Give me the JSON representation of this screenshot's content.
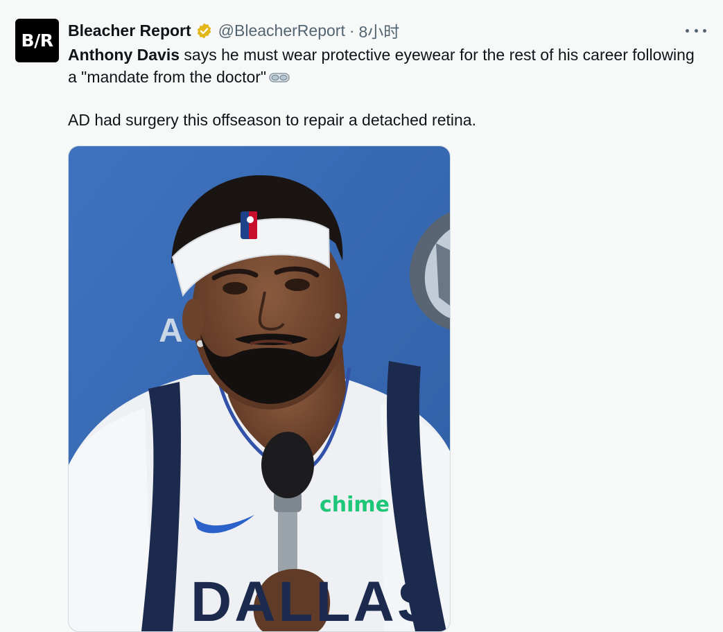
{
  "tweet": {
    "avatar_text": "B/R",
    "display_name": "Bleacher Report",
    "handle": "@BleacherReport",
    "separator": "·",
    "time": "8小时",
    "text": {
      "bold_name": "Anthony Davis",
      "line1_rest": " says he must wear protective eyewear for the rest of his career following a \"mandate from the doctor\"",
      "line2": "AD had surgery this offseason to repair a detached retina."
    },
    "icons": {
      "verified": "verified-badge-icon",
      "more": "more-options-icon",
      "goggles": "goggles-emoji-icon"
    },
    "media": {
      "jersey_sponsor": "chime",
      "jersey_team": "DALLAS",
      "backdrop_letter": "A"
    }
  },
  "colors": {
    "verified_gold": "#e2b719",
    "media_backdrop_blue": "#3a6bb5",
    "chime_green": "#1ec677",
    "nike_blue": "#2b62c9",
    "jersey_navy": "#1c2a4d"
  }
}
